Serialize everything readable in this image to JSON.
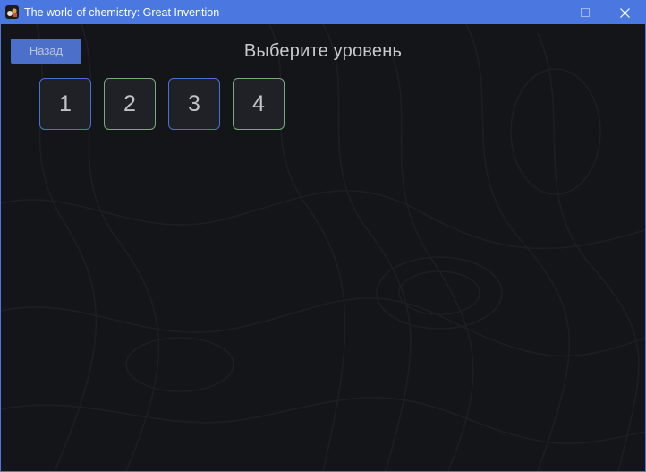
{
  "window": {
    "title": "The world of chemistry: Great Invention",
    "icon": "app-icon",
    "controls": [
      "minimize-icon",
      "maximize-icon",
      "close-icon"
    ]
  },
  "screen": {
    "back_label": "Назад",
    "title": "Выберите уровень"
  },
  "levels": [
    {
      "label": "1",
      "accent": "#4a6fd6"
    },
    {
      "label": "2",
      "accent": "#7aaa78"
    },
    {
      "label": "3",
      "accent": "#4a6fd6"
    },
    {
      "label": "4",
      "accent": "#7aaa78"
    }
  ],
  "colors": {
    "titlebar": "#4a78e0",
    "background": "#141518",
    "button": "#5178d8",
    "tile_bg": "#202127",
    "text": "#c8c9cf"
  }
}
